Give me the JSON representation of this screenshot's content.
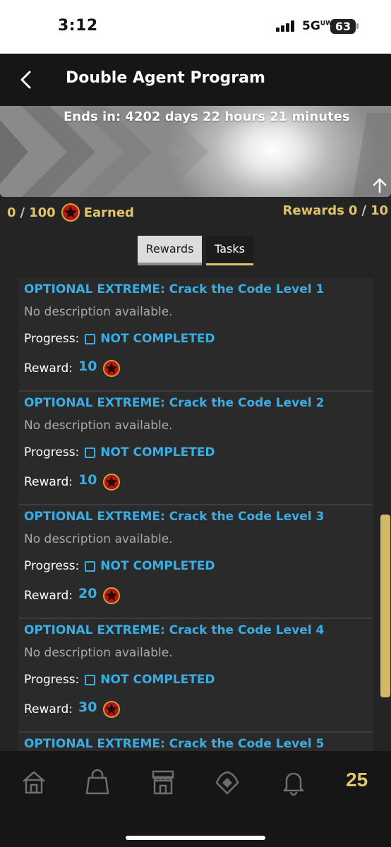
{
  "status_bar": {
    "time": "3:12",
    "network": "5G",
    "network_sup": "UW",
    "battery": "63"
  },
  "header": {
    "title": "Double Agent Program"
  },
  "banner": {
    "ends_in": "Ends in: 4202 days 22 hours 21 minutes"
  },
  "summary": {
    "earned_current": "0",
    "earned_total": "100",
    "earned_label": "Earned",
    "rewards_label": "Rewards",
    "rewards_current": "0",
    "rewards_total": "10",
    "separator": "/"
  },
  "tabs": [
    {
      "label": "Rewards",
      "active": false
    },
    {
      "label": "Tasks",
      "active": true
    }
  ],
  "tasks": [
    {
      "title": "OPTIONAL EXTREME: Crack the Code Level 1",
      "description": "No description available.",
      "progress_label": "Progress:",
      "status": "NOT COMPLETED",
      "reward_label": "Reward:",
      "reward": "10"
    },
    {
      "title": "OPTIONAL EXTREME: Crack the Code Level 2",
      "description": "No description available.",
      "progress_label": "Progress:",
      "status": "NOT COMPLETED",
      "reward_label": "Reward:",
      "reward": "10"
    },
    {
      "title": "OPTIONAL EXTREME: Crack the Code Level 3",
      "description": "No description available.",
      "progress_label": "Progress:",
      "status": "NOT COMPLETED",
      "reward_label": "Reward:",
      "reward": "20"
    },
    {
      "title": "OPTIONAL EXTREME: Crack the Code Level 4",
      "description": "No description available.",
      "progress_label": "Progress:",
      "status": "NOT COMPLETED",
      "reward_label": "Reward:",
      "reward": "30"
    },
    {
      "title": "OPTIONAL EXTREME: Crack the Code Level 5",
      "description": "",
      "progress_label": "",
      "status": "",
      "reward_label": "",
      "reward": ""
    }
  ],
  "bottom_nav": {
    "items": [
      "home-icon",
      "bag-icon",
      "store-icon",
      "diamond-icon",
      "bell-icon"
    ],
    "level_badge": "25"
  },
  "colors": {
    "accent_gold": "#e0c36a",
    "accent_blue": "#3aaee4",
    "background": "#242424",
    "card": "#2a2a2a"
  }
}
